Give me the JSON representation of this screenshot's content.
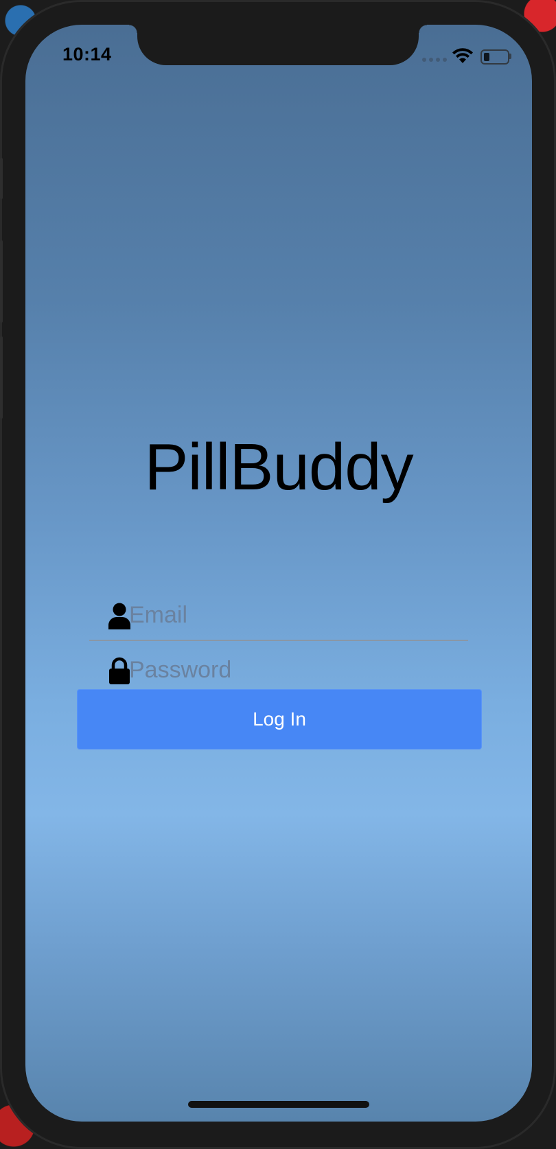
{
  "status_bar": {
    "time": "10:14",
    "signal_icon": "cellular-signal-icon",
    "wifi_icon": "wifi-icon",
    "battery_icon": "battery-icon",
    "battery_level": 0.25
  },
  "app": {
    "title": "PillBuddy"
  },
  "login_form": {
    "email": {
      "icon": "user-icon",
      "placeholder": "Email",
      "value": ""
    },
    "password": {
      "icon": "lock-icon",
      "placeholder": "Password",
      "value": ""
    },
    "login_button_label": "Log In"
  },
  "colors": {
    "button": "#4787f5",
    "background_top": "#4a6e94",
    "background_mid": "#83b6e7",
    "placeholder": "#6a82a0"
  }
}
